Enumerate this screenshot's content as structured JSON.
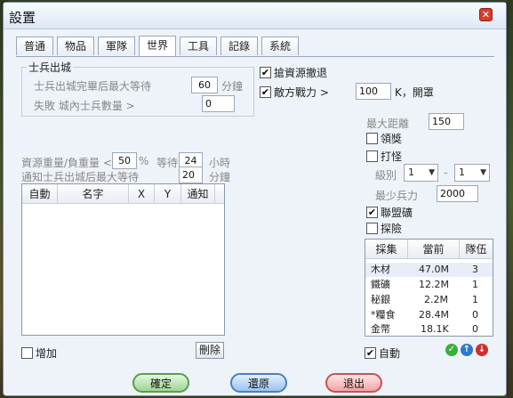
{
  "window": {
    "title": "設置"
  },
  "tabs": [
    {
      "label": "普通",
      "active": false
    },
    {
      "label": "物品",
      "active": false
    },
    {
      "label": "軍隊",
      "active": false
    },
    {
      "label": "世界",
      "active": true
    },
    {
      "label": "工具",
      "active": false
    },
    {
      "label": "記錄",
      "active": false
    },
    {
      "label": "系統",
      "active": false
    }
  ],
  "troops_out": {
    "group_label": "士兵出城",
    "max_wait_label": "士兵出城完畢后最大等待",
    "max_wait_value": "60",
    "max_wait_unit": "分鐘",
    "fail_label": "失敗 城內士兵數量 >",
    "fail_value": "0"
  },
  "right_checks": {
    "grab_retreat": {
      "label": "搶資源撤退",
      "checked": true
    },
    "enemy_power": {
      "label": "敵方戰力 >",
      "checked": true,
      "value": "100",
      "suffix": "K，開罩"
    }
  },
  "resource_weight": {
    "prefix": "資源重量/負重量 <",
    "value": "50",
    "pct": "%",
    "wait_label": "等待",
    "wait_value": "24",
    "wait_unit": "小時"
  },
  "notify": {
    "label": "通知士兵出城后最大等待",
    "value": "20",
    "unit": "分鐘"
  },
  "left_list": {
    "columns": [
      "自動",
      "名字",
      "X",
      "Y",
      "通知"
    ],
    "add_label": "增加",
    "delete_label": "刪除"
  },
  "right_panel": {
    "max_distance_label": "最大距離",
    "max_distance_value": "150",
    "reward_label": "領獎",
    "monster_label": "打怪",
    "level_label": "級別",
    "level_from": "1",
    "level_dash": "-",
    "level_to": "1",
    "min_troops_label": "最少兵力",
    "min_troops_value": "2000",
    "alliance_mine_label": "聯盟礦",
    "explore_label": "探險",
    "auto_label": "自動"
  },
  "resource_table": {
    "columns": [
      "採集",
      "當前",
      "隊伍"
    ],
    "rows": [
      {
        "name": "木材",
        "current": "47.0M",
        "teams": "3"
      },
      {
        "name": "鐵礦",
        "current": "12.2M",
        "teams": "1"
      },
      {
        "name": "秘銀",
        "current": "2.2M",
        "teams": "1"
      },
      {
        "name": "*糧食",
        "current": "28.4M",
        "teams": "0"
      },
      {
        "name": "金幣",
        "current": "18.1K",
        "teams": "0"
      }
    ]
  },
  "footer": {
    "confirm_label": "確定",
    "restore_label": "還原",
    "exit_label": "退出"
  },
  "colors": {
    "confirm": "#9ed594",
    "restore": "#9cc4f0",
    "exit": "#f2a3a3"
  }
}
